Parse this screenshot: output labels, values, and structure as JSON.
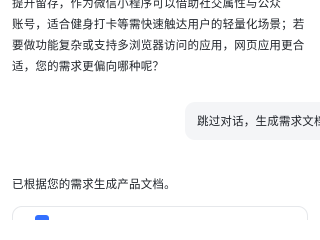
{
  "chat": {
    "assistant_message_lines": [
      "提升留存，作为微信小程序可以借助社交属性与公众",
      "账号，适合健身打卡等需快速触达用户的轻量化场景；若",
      "要做功能复杂或支持多浏览器访问的应用，网页应用更合",
      "适，您的需求更偏向哪种呢？"
    ],
    "user_message": "跳过对话，生成需求文档",
    "status_text": "已根据您的需求生成产品文档。"
  },
  "document_card": {
    "icon": "document-icon",
    "accent_color": "#3370ff"
  }
}
